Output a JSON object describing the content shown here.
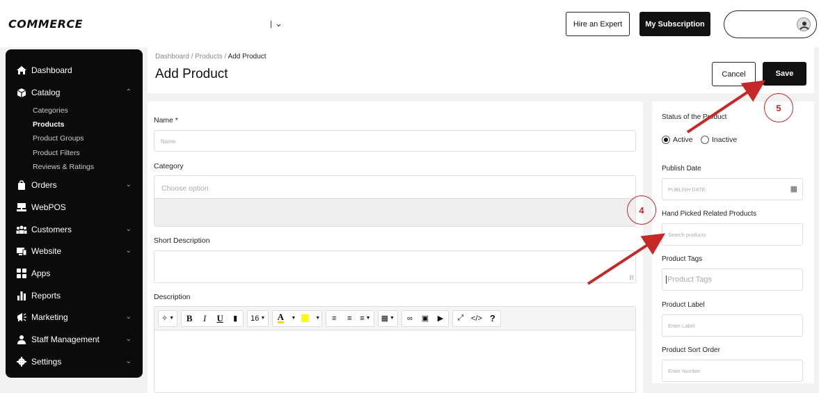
{
  "header": {
    "logo": "COMMERCE",
    "store_select": "|",
    "hire_expert": "Hire an Expert",
    "subscription": "My Subscription"
  },
  "sidebar": {
    "items": [
      {
        "label": "Dashboard",
        "icon": "home-icon"
      },
      {
        "label": "Catalog",
        "icon": "box-icon"
      },
      {
        "label": "Orders",
        "icon": "bag-icon"
      },
      {
        "label": "WebPOS",
        "icon": "pos-icon"
      },
      {
        "label": "Customers",
        "icon": "users-icon"
      },
      {
        "label": "Website",
        "icon": "monitor-icon"
      },
      {
        "label": "Apps",
        "icon": "apps-icon"
      },
      {
        "label": "Reports",
        "icon": "bar-chart-icon"
      },
      {
        "label": "Marketing",
        "icon": "megaphone-icon"
      },
      {
        "label": "Staff Management",
        "icon": "staff-icon"
      },
      {
        "label": "Settings",
        "icon": "gear-icon"
      }
    ],
    "catalog_sub": [
      "Categories",
      "Products",
      "Product Groups",
      "Product Filters",
      "Reviews & Ratings"
    ]
  },
  "page": {
    "breadcrumb_1": "Dashboard",
    "breadcrumb_2": "Products",
    "breadcrumb_3": "Add Product",
    "sep": " / ",
    "title": "Add Product",
    "cancel": "Cancel",
    "save": "Save"
  },
  "form": {
    "name_label": "Name *",
    "name_placeholder": "Name",
    "category_label": "Category",
    "category_placeholder": "Choose option",
    "short_desc_label": "Short Description",
    "desc_label": "Description",
    "font_size": "16"
  },
  "right": {
    "status_label": "Status of the Product",
    "active": "Active",
    "inactive": "Inactive",
    "publish_label": "Publish Date",
    "publish_placeholder": "PUBLISH DATE",
    "related_label": "Hand Picked Related Products",
    "related_placeholder": "Search products",
    "tags_label": "Product Tags",
    "tags_placeholder": "Product Tags",
    "prod_label": "Product Label",
    "prod_label_placeholder": "Enter Label",
    "sort_label": "Product Sort Order",
    "sort_placeholder": "Enter Number"
  },
  "annotations": {
    "step4": "4",
    "step5": "5",
    "color": "#c62828"
  }
}
